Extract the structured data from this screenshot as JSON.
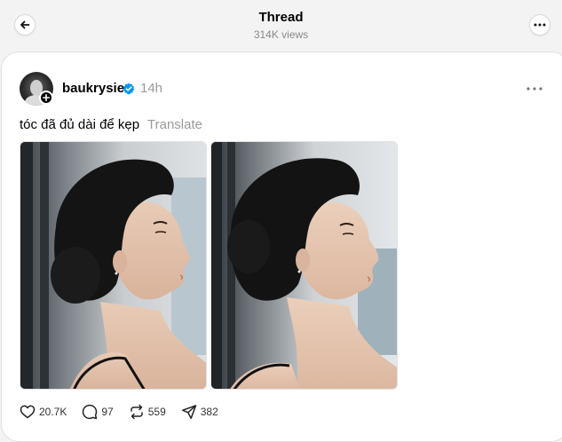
{
  "header": {
    "title": "Thread",
    "views": "314K views",
    "back_icon": "arrow-left-icon",
    "more_icon": "more-horizontal-icon"
  },
  "post": {
    "username": "baukrysie",
    "verified": true,
    "verified_color": "#0095f6",
    "time_ago": "14h",
    "text": "tóc đã đủ dài để kẹp",
    "translate_label": "Translate",
    "images": [
      {
        "label": "profile-photo-left",
        "icon": "photo"
      },
      {
        "label": "profile-photo-right",
        "icon": "photo"
      }
    ],
    "actions": {
      "likes": "20.7K",
      "replies": "97",
      "reposts": "559",
      "shares": "382"
    }
  }
}
